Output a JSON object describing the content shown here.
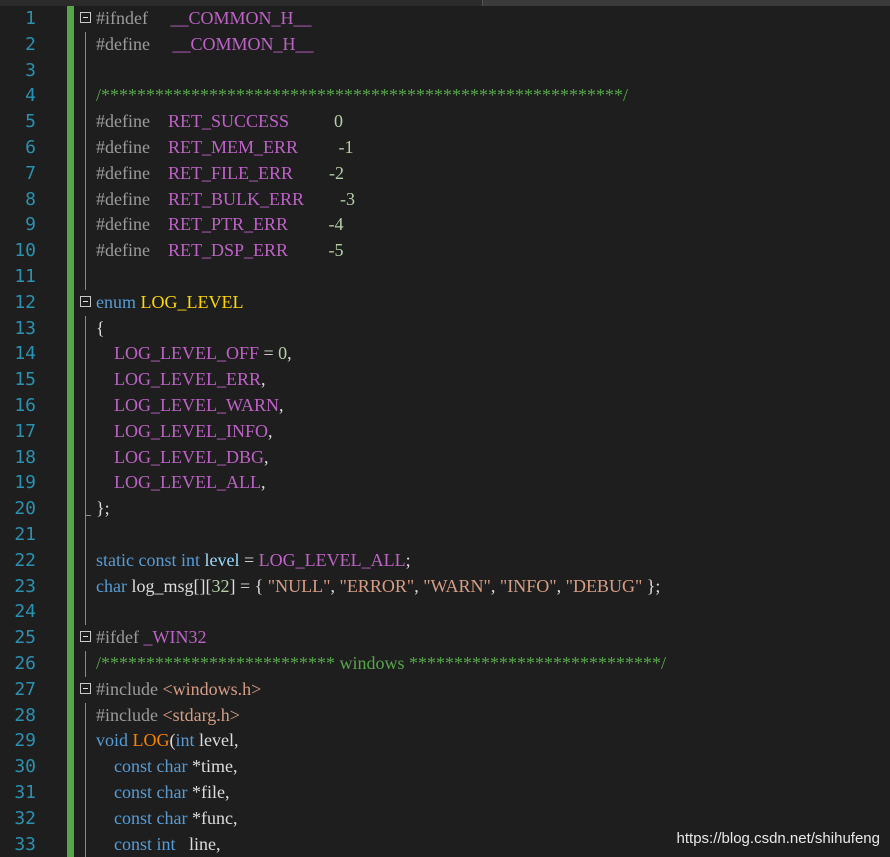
{
  "editor": {
    "lines": [
      {
        "n": "1",
        "fold": true,
        "tokens": [
          {
            "t": "#ifndef",
            "c": "pp"
          },
          {
            "t": "     ",
            "c": "txt"
          },
          {
            "t": "__COMMON_H__",
            "c": "mac"
          }
        ]
      },
      {
        "n": "2",
        "fold": false,
        "tokens": [
          {
            "t": "#define",
            "c": "pp"
          },
          {
            "t": "     ",
            "c": "txt"
          },
          {
            "t": "__COMMON_H__",
            "c": "mac"
          }
        ]
      },
      {
        "n": "3",
        "fold": false,
        "tokens": []
      },
      {
        "n": "4",
        "fold": false,
        "tokens": [
          {
            "t": "/**********************************************************/",
            "c": "cm"
          }
        ]
      },
      {
        "n": "5",
        "fold": false,
        "tokens": [
          {
            "t": "#define",
            "c": "pp"
          },
          {
            "t": "    ",
            "c": "txt"
          },
          {
            "t": "RET_SUCCESS",
            "c": "mac"
          },
          {
            "t": "          ",
            "c": "txt"
          },
          {
            "t": "0",
            "c": "num"
          }
        ]
      },
      {
        "n": "6",
        "fold": false,
        "tokens": [
          {
            "t": "#define",
            "c": "pp"
          },
          {
            "t": "    ",
            "c": "txt"
          },
          {
            "t": "RET_MEM_ERR",
            "c": "mac"
          },
          {
            "t": "         ",
            "c": "txt"
          },
          {
            "t": "-1",
            "c": "num"
          }
        ]
      },
      {
        "n": "7",
        "fold": false,
        "tokens": [
          {
            "t": "#define",
            "c": "pp"
          },
          {
            "t": "    ",
            "c": "txt"
          },
          {
            "t": "RET_FILE_ERR",
            "c": "mac"
          },
          {
            "t": "        ",
            "c": "txt"
          },
          {
            "t": "-2",
            "c": "num"
          }
        ]
      },
      {
        "n": "8",
        "fold": false,
        "tokens": [
          {
            "t": "#define",
            "c": "pp"
          },
          {
            "t": "    ",
            "c": "txt"
          },
          {
            "t": "RET_BULK_ERR",
            "c": "mac"
          },
          {
            "t": "        ",
            "c": "txt"
          },
          {
            "t": "-3",
            "c": "num"
          }
        ]
      },
      {
        "n": "9",
        "fold": false,
        "tokens": [
          {
            "t": "#define",
            "c": "pp"
          },
          {
            "t": "    ",
            "c": "txt"
          },
          {
            "t": "RET_PTR_ERR",
            "c": "mac"
          },
          {
            "t": "         ",
            "c": "txt"
          },
          {
            "t": "-4",
            "c": "num"
          }
        ]
      },
      {
        "n": "10",
        "fold": false,
        "tokens": [
          {
            "t": "#define",
            "c": "pp"
          },
          {
            "t": "    ",
            "c": "txt"
          },
          {
            "t": "RET_DSP_ERR",
            "c": "mac"
          },
          {
            "t": "         ",
            "c": "txt"
          },
          {
            "t": "-5",
            "c": "num"
          }
        ]
      },
      {
        "n": "11",
        "fold": false,
        "tokens": []
      },
      {
        "n": "12",
        "fold": true,
        "tokens": [
          {
            "t": "enum",
            "c": "kw"
          },
          {
            "t": " ",
            "c": "txt"
          },
          {
            "t": "LOG_LEVEL",
            "c": "type"
          }
        ]
      },
      {
        "n": "13",
        "fold": false,
        "tokens": [
          {
            "t": "{",
            "c": "txt"
          }
        ]
      },
      {
        "n": "14",
        "fold": false,
        "tokens": [
          {
            "t": "    LOG_LEVEL_OFF",
            "c": "eval"
          },
          {
            "t": " = ",
            "c": "txt"
          },
          {
            "t": "0",
            "c": "num"
          },
          {
            "t": ",",
            "c": "txt"
          }
        ]
      },
      {
        "n": "15",
        "fold": false,
        "tokens": [
          {
            "t": "    LOG_LEVEL_ERR",
            "c": "eval"
          },
          {
            "t": ",",
            "c": "txt"
          }
        ]
      },
      {
        "n": "16",
        "fold": false,
        "tokens": [
          {
            "t": "    LOG_LEVEL_WARN",
            "c": "eval"
          },
          {
            "t": ",",
            "c": "txt"
          }
        ]
      },
      {
        "n": "17",
        "fold": false,
        "tokens": [
          {
            "t": "    LOG_LEVEL_INFO",
            "c": "eval"
          },
          {
            "t": ",",
            "c": "txt"
          }
        ]
      },
      {
        "n": "18",
        "fold": false,
        "tokens": [
          {
            "t": "    LOG_LEVEL_DBG",
            "c": "eval"
          },
          {
            "t": ",",
            "c": "txt"
          }
        ]
      },
      {
        "n": "19",
        "fold": false,
        "tokens": [
          {
            "t": "    LOG_LEVEL_ALL",
            "c": "eval"
          },
          {
            "t": ",",
            "c": "txt"
          }
        ]
      },
      {
        "n": "20",
        "fold": false,
        "tokens": [
          {
            "t": "};",
            "c": "txt"
          }
        ]
      },
      {
        "n": "21",
        "fold": false,
        "tokens": []
      },
      {
        "n": "22",
        "fold": false,
        "tokens": [
          {
            "t": "static",
            "c": "kw"
          },
          {
            "t": " ",
            "c": "txt"
          },
          {
            "t": "const",
            "c": "kw"
          },
          {
            "t": " ",
            "c": "txt"
          },
          {
            "t": "int",
            "c": "kw"
          },
          {
            "t": " ",
            "c": "txt"
          },
          {
            "t": "level",
            "c": "var"
          },
          {
            "t": " = ",
            "c": "txt"
          },
          {
            "t": "LOG_LEVEL_ALL",
            "c": "eval"
          },
          {
            "t": ";",
            "c": "txt"
          }
        ]
      },
      {
        "n": "23",
        "fold": false,
        "tokens": [
          {
            "t": "char",
            "c": "kw"
          },
          {
            "t": " log_msg[][",
            "c": "txt"
          },
          {
            "t": "32",
            "c": "num"
          },
          {
            "t": "] = { ",
            "c": "txt"
          },
          {
            "t": "\"NULL\"",
            "c": "str"
          },
          {
            "t": ", ",
            "c": "txt"
          },
          {
            "t": "\"ERROR\"",
            "c": "str"
          },
          {
            "t": ", ",
            "c": "txt"
          },
          {
            "t": "\"WARN\"",
            "c": "str"
          },
          {
            "t": ", ",
            "c": "txt"
          },
          {
            "t": "\"INFO\"",
            "c": "str"
          },
          {
            "t": ", ",
            "c": "txt"
          },
          {
            "t": "\"DEBUG\"",
            "c": "str"
          },
          {
            "t": " };",
            "c": "txt"
          }
        ]
      },
      {
        "n": "24",
        "fold": false,
        "tokens": []
      },
      {
        "n": "25",
        "fold": true,
        "tokens": [
          {
            "t": "#ifdef",
            "c": "pp"
          },
          {
            "t": " ",
            "c": "txt"
          },
          {
            "t": "_WIN32",
            "c": "mac"
          }
        ]
      },
      {
        "n": "26",
        "fold": false,
        "tokens": [
          {
            "t": "/************************** windows ****************************/",
            "c": "cm"
          }
        ]
      },
      {
        "n": "27",
        "fold": true,
        "tokens": [
          {
            "t": "#include",
            "c": "pp"
          },
          {
            "t": " ",
            "c": "txt"
          },
          {
            "t": "<windows.h>",
            "c": "str"
          }
        ]
      },
      {
        "n": "28",
        "fold": false,
        "tokens": [
          {
            "t": "#include",
            "c": "pp"
          },
          {
            "t": " ",
            "c": "txt"
          },
          {
            "t": "<stdarg.h>",
            "c": "str"
          }
        ]
      },
      {
        "n": "29",
        "fold": false,
        "tokens": [
          {
            "t": "void",
            "c": "kw"
          },
          {
            "t": " ",
            "c": "txt"
          },
          {
            "t": "LOG",
            "c": "fn"
          },
          {
            "t": "(",
            "c": "txt"
          },
          {
            "t": "int",
            "c": "kw"
          },
          {
            "t": " level,",
            "c": "txt"
          }
        ]
      },
      {
        "n": "30",
        "fold": false,
        "tokens": [
          {
            "t": "    ",
            "c": "txt"
          },
          {
            "t": "const",
            "c": "kw"
          },
          {
            "t": " ",
            "c": "txt"
          },
          {
            "t": "char",
            "c": "kw"
          },
          {
            "t": " *time,",
            "c": "txt"
          }
        ]
      },
      {
        "n": "31",
        "fold": false,
        "tokens": [
          {
            "t": "    ",
            "c": "txt"
          },
          {
            "t": "const",
            "c": "kw"
          },
          {
            "t": " ",
            "c": "txt"
          },
          {
            "t": "char",
            "c": "kw"
          },
          {
            "t": " *file,",
            "c": "txt"
          }
        ]
      },
      {
        "n": "32",
        "fold": false,
        "tokens": [
          {
            "t": "    ",
            "c": "txt"
          },
          {
            "t": "const",
            "c": "kw"
          },
          {
            "t": " ",
            "c": "txt"
          },
          {
            "t": "char",
            "c": "kw"
          },
          {
            "t": " *func,",
            "c": "txt"
          }
        ]
      },
      {
        "n": "33",
        "fold": false,
        "tokens": [
          {
            "t": "    ",
            "c": "txt"
          },
          {
            "t": "const",
            "c": "kw"
          },
          {
            "t": " ",
            "c": "txt"
          },
          {
            "t": "int",
            "c": "kw"
          },
          {
            "t": "   line,",
            "c": "txt"
          }
        ]
      }
    ]
  },
  "watermark": "https://blog.csdn.net/shihufeng",
  "colors": {
    "background": "#1e1e1e",
    "line_number": "#2b91af",
    "change_bar": "#57a64a",
    "preprocessor": "#9b9b9b",
    "macro": "#bd63c5",
    "keyword": "#569cd6",
    "comment": "#57a64a",
    "string": "#d69d85",
    "type": "#ffd700",
    "function": "#ff8000"
  }
}
